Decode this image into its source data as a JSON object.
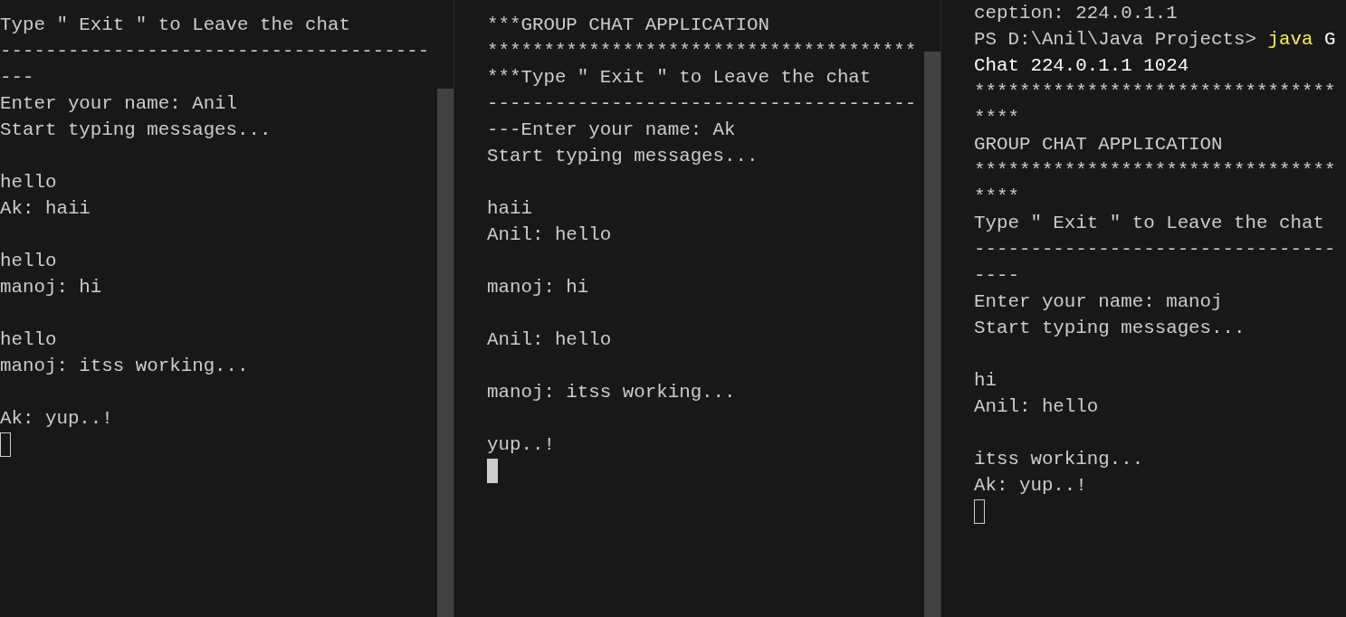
{
  "panes": [
    {
      "scrollbar": true,
      "cursor_focused": false,
      "lines": [
        {
          "kind": "text",
          "text": "Type \" Exit \" to Leave the chat"
        },
        {
          "kind": "text",
          "text": "--------------------------------------"
        },
        {
          "kind": "text",
          "text": "---"
        },
        {
          "kind": "text",
          "text": "Enter your name: Anil"
        },
        {
          "kind": "text",
          "text": "Start typing messages..."
        },
        {
          "kind": "blank"
        },
        {
          "kind": "text",
          "text": "hello"
        },
        {
          "kind": "text",
          "text": "Ak: haii"
        },
        {
          "kind": "blank"
        },
        {
          "kind": "text",
          "text": "hello"
        },
        {
          "kind": "text",
          "text": "manoj: hi"
        },
        {
          "kind": "blank"
        },
        {
          "kind": "text",
          "text": "hello"
        },
        {
          "kind": "text",
          "text": "manoj: itss working..."
        },
        {
          "kind": "blank"
        },
        {
          "kind": "text",
          "text": "Ak: yup..!"
        },
        {
          "kind": "blank"
        }
      ]
    },
    {
      "scrollbar": true,
      "cursor_focused": true,
      "lines": [
        {
          "kind": "text",
          "text": "***GROUP CHAT APPLICATION"
        },
        {
          "kind": "text",
          "text": "**************************************"
        },
        {
          "kind": "text",
          "text": "***Type \" Exit \" to Leave the chat"
        },
        {
          "kind": "text",
          "text": "--------------------------------------"
        },
        {
          "kind": "text",
          "text": "---Enter your name: Ak"
        },
        {
          "kind": "text",
          "text": "Start typing messages..."
        },
        {
          "kind": "blank"
        },
        {
          "kind": "text",
          "text": "haii"
        },
        {
          "kind": "text",
          "text": "Anil: hello"
        },
        {
          "kind": "blank"
        },
        {
          "kind": "text",
          "text": "manoj: hi"
        },
        {
          "kind": "blank"
        },
        {
          "kind": "text",
          "text": "Anil: hello"
        },
        {
          "kind": "blank"
        },
        {
          "kind": "text",
          "text": "manoj: itss working..."
        },
        {
          "kind": "blank"
        },
        {
          "kind": "text",
          "text": "yup..!"
        }
      ]
    },
    {
      "scrollbar": false,
      "cursor_focused": false,
      "lines": [
        {
          "kind": "text",
          "text": "ception: 224.0.1.1"
        },
        {
          "kind": "parts",
          "parts": [
            {
              "kind": "prompt",
              "text": "PS D:\\Anil\\Java Projects> "
            },
            {
              "kind": "command",
              "text": "java"
            },
            {
              "kind": "argument",
              "text": " G"
            }
          ]
        },
        {
          "kind": "parts",
          "parts": [
            {
              "kind": "argument",
              "text": "Chat 224.0.1.1 1024"
            }
          ]
        },
        {
          "kind": "text",
          "text": "********************************"
        },
        {
          "kind": "text",
          "text": "****"
        },
        {
          "kind": "text",
          "text": "GROUP CHAT APPLICATION"
        },
        {
          "kind": "text",
          "text": "********************************"
        },
        {
          "kind": "text",
          "text": "****"
        },
        {
          "kind": "text",
          "text": "Type \" Exit \" to Leave the chat"
        },
        {
          "kind": "text",
          "text": "--------------------------------"
        },
        {
          "kind": "text",
          "text": "----"
        },
        {
          "kind": "text",
          "text": "Enter your name: manoj"
        },
        {
          "kind": "text",
          "text": "Start typing messages..."
        },
        {
          "kind": "blank"
        },
        {
          "kind": "text",
          "text": "hi"
        },
        {
          "kind": "text",
          "text": "Anil: hello"
        },
        {
          "kind": "blank"
        },
        {
          "kind": "text",
          "text": "itss working..."
        },
        {
          "kind": "text",
          "text": "Ak: yup..!"
        },
        {
          "kind": "blank"
        }
      ]
    }
  ]
}
